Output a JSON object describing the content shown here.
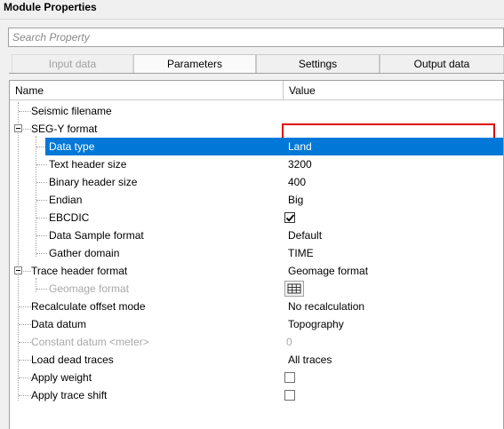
{
  "window": {
    "title": "Module Properties"
  },
  "search": {
    "placeholder": "Search Property",
    "value": ""
  },
  "tabs": [
    {
      "label": "Input data",
      "state": "disabled"
    },
    {
      "label": "Parameters",
      "state": "active"
    },
    {
      "label": "Settings",
      "state": "normal"
    },
    {
      "label": "Output data",
      "state": "normal"
    }
  ],
  "grid": {
    "columns": {
      "name": "Name",
      "value": "Value"
    },
    "rows": [
      {
        "name": "Seismic filename",
        "value": "",
        "required": true
      },
      {
        "name": "SEG-Y format",
        "value": "",
        "expandable": true
      },
      {
        "name": "Data type",
        "value": "Land",
        "selected": true
      },
      {
        "name": "Text header size",
        "value": "3200"
      },
      {
        "name": "Binary header size",
        "value": "400"
      },
      {
        "name": "Endian",
        "value": "Big"
      },
      {
        "name": "EBCDIC",
        "value": "",
        "checkbox": true,
        "checked": true
      },
      {
        "name": "Data Sample format",
        "value": "Default"
      },
      {
        "name": "Gather domain",
        "value": "TIME"
      },
      {
        "name": "Trace header format",
        "value": "Geomage format",
        "expandable": true
      },
      {
        "name": "Geomage format",
        "value": "",
        "disabled": true,
        "icon": "table-grid-icon"
      },
      {
        "name": "Recalculate offset mode",
        "value": "No recalculation"
      },
      {
        "name": "Data datum",
        "value": "Topography"
      },
      {
        "name": "Constant datum <meter>",
        "value": "0",
        "disabled": true
      },
      {
        "name": "Load dead traces",
        "value": "All traces"
      },
      {
        "name": "Apply weight",
        "value": "",
        "checkbox": true,
        "checked": false
      },
      {
        "name": "Apply trace shift",
        "value": "",
        "checkbox": true,
        "checked": false
      }
    ]
  },
  "colors": {
    "selection": "#0078d7",
    "required_border": "#e00000"
  }
}
